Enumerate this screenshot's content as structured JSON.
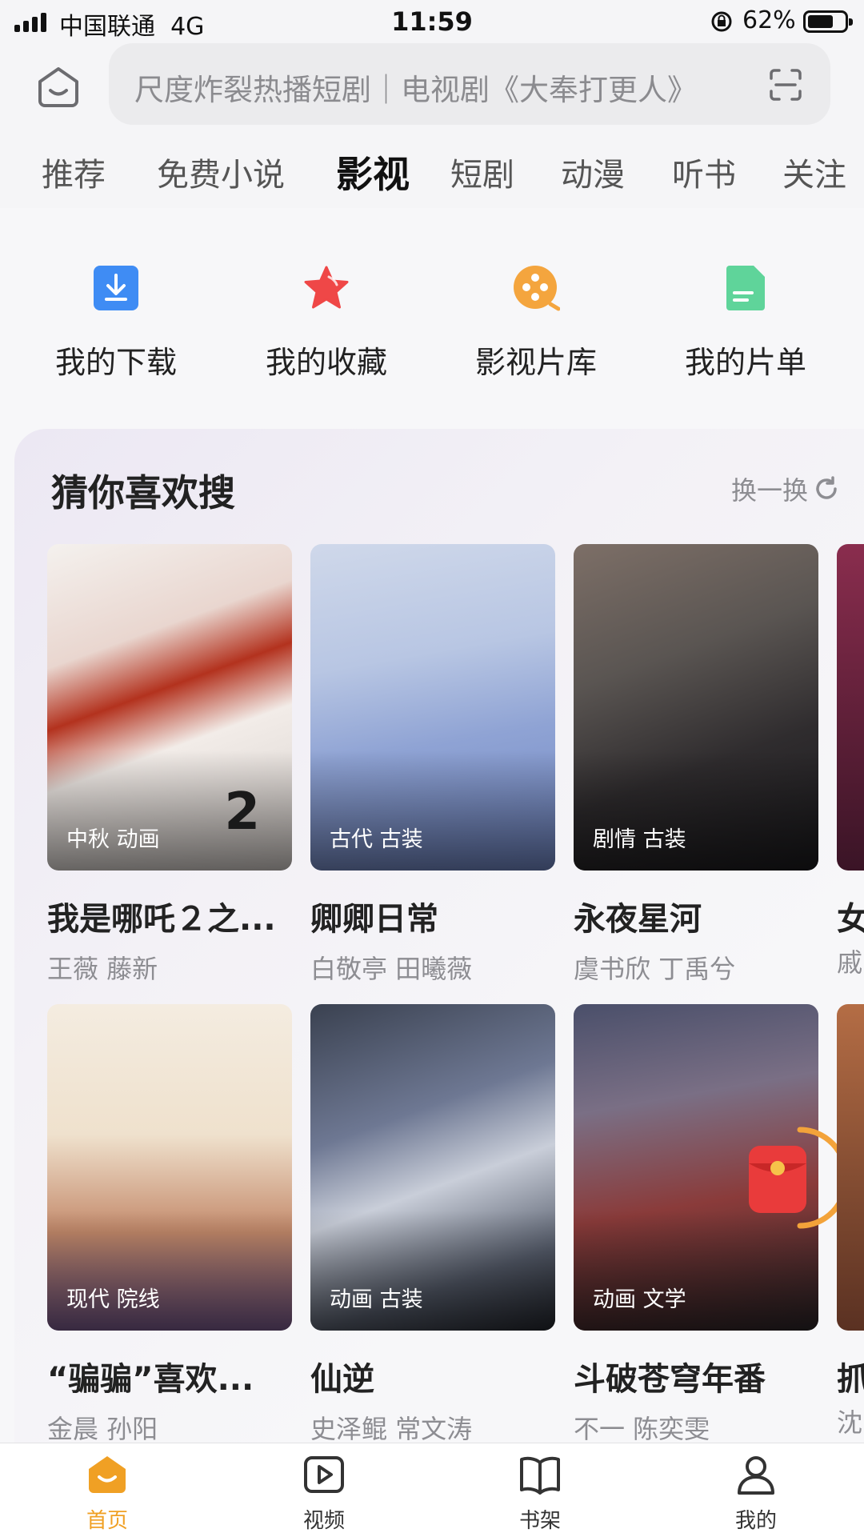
{
  "status_bar": {
    "carrier": "中国联通",
    "network": "4G",
    "time": "11:59",
    "battery_text": "62%",
    "battery_level": 0.62
  },
  "search": {
    "placeholder": "尺度炸裂热播短剧｜电视剧《大奉打更人》",
    "home_icon": "home-face-icon",
    "scan_icon": "scan-icon"
  },
  "tabs": [
    "推荐",
    "免费小说",
    "影视",
    "短剧",
    "动漫",
    "听书",
    "关注"
  ],
  "active_tab": "影视",
  "quick_actions": [
    {
      "label": "我的下载",
      "icon": "download-icon",
      "color": "#3f8cf4"
    },
    {
      "label": "我的收藏",
      "icon": "star-icon",
      "color": "#ef4747"
    },
    {
      "label": "影视片库",
      "icon": "film-reel-icon",
      "color": "#f4a53e"
    },
    {
      "label": "我的片单",
      "icon": "list-doc-icon",
      "color": "#5fd49a"
    }
  ],
  "section": {
    "title": "猜你喜欢搜",
    "refresh_label": "换一换"
  },
  "cards": [
    {
      "title": "我是哪吒２之...",
      "cast": "王薇 藤新",
      "tags": "中秋 动画"
    },
    {
      "title": "卿卿日常",
      "cast": "白敬亭 田曦薇",
      "tags": "古代 古装"
    },
    {
      "title": "永夜星河",
      "cast": "虞书欣 丁禹兮",
      "tags": "剧情 古装"
    },
    {
      "title": "“骗骗”喜欢...",
      "cast": "金晨 孙阳",
      "tags": "现代 院线"
    },
    {
      "title": "仙逆",
      "cast": "史泽鲲 常文涛",
      "tags": "动画 古装"
    },
    {
      "title": "斗破苍穹年番",
      "cast": "不一 陈奕雯",
      "tags": "动画 文学"
    }
  ],
  "peek_cards": [
    {
      "title": "女",
      "cast": "戚"
    },
    {
      "title": "抓",
      "cast": "沈"
    }
  ],
  "bottom_nav": [
    {
      "label": "首页",
      "icon": "home-icon",
      "active": true
    },
    {
      "label": "视频",
      "icon": "video-icon",
      "active": false
    },
    {
      "label": "书架",
      "icon": "book-icon",
      "active": false
    },
    {
      "label": "我的",
      "icon": "person-icon",
      "active": false
    }
  ],
  "accent_color": "#f0a024"
}
